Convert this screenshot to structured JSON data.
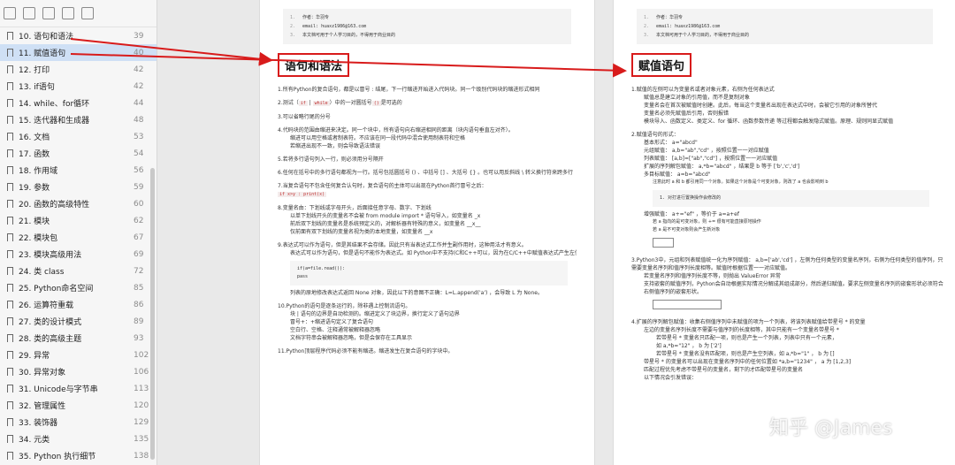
{
  "sidebar": {
    "items": [
      {
        "label": "10. 语句和语法",
        "page": "39",
        "selected": false
      },
      {
        "label": "11. 赋值语句",
        "page": "40",
        "selected": true
      },
      {
        "label": "12. 打印",
        "page": "42",
        "selected": false
      },
      {
        "label": "13. if语句",
        "page": "42",
        "selected": false
      },
      {
        "label": "14. while、for循环",
        "page": "44",
        "selected": false
      },
      {
        "label": "15. 迭代器和生成器",
        "page": "48",
        "selected": false
      },
      {
        "label": "16. 文档",
        "page": "53",
        "selected": false
      },
      {
        "label": "17. 函数",
        "page": "54",
        "selected": false
      },
      {
        "label": "18. 作用域",
        "page": "56",
        "selected": false
      },
      {
        "label": "19. 参数",
        "page": "59",
        "selected": false
      },
      {
        "label": "20. 函数的高级特性",
        "page": "60",
        "selected": false
      },
      {
        "label": "21. 模块",
        "page": "62",
        "selected": false
      },
      {
        "label": "22. 模块包",
        "page": "67",
        "selected": false
      },
      {
        "label": "23. 模块高级用法",
        "page": "69",
        "selected": false
      },
      {
        "label": "24. 类 class",
        "page": "72",
        "selected": false
      },
      {
        "label": "25. Python命名空间",
        "page": "85",
        "selected": false
      },
      {
        "label": "26. 运算符重载",
        "page": "86",
        "selected": false
      },
      {
        "label": "27. 类的设计模式",
        "page": "89",
        "selected": false
      },
      {
        "label": "28. 类的高级主题",
        "page": "93",
        "selected": false
      },
      {
        "label": "29. 异常",
        "page": "102",
        "selected": false
      },
      {
        "label": "30. 异常对象",
        "page": "106",
        "selected": false
      },
      {
        "label": "31. Unicode与字节串",
        "page": "113",
        "selected": false
      },
      {
        "label": "32. 管理属性",
        "page": "120",
        "selected": false
      },
      {
        "label": "33. 装饰器",
        "page": "129",
        "selected": false
      },
      {
        "label": "34. 元类",
        "page": "135",
        "selected": false
      },
      {
        "label": "35. Python 执行细节",
        "page": "138",
        "selected": false
      }
    ]
  },
  "page1": {
    "code_lines": [
      "作者：华羽专",
      "email: huaxz1986@163.com",
      "本文档可用于个人学习目的，不得用于商业目的"
    ],
    "title": "语句和语法",
    "p1": "1.所有Python的复合语句，都是以冒号 : 结尾，下一行缩进开始进入代码块。同一个级别代码块的缩进形式相同",
    "p2a": "2.测试（",
    "p2code1": "if",
    "p2code2": "while",
    "p2b": "）中的一对圆括号",
    "p2code3": "()",
    "p2c": "是可选的",
    "p3": "3.可以省略行尾的分号",
    "p4": "4.代码块的范围由缩进来决定。同一个块中，所有语句向右缩进相同的距离（块内语句垂直左对齐）。",
    "b4a": "缩进可以用空格或者制表符。不应该在同一段代码中混合使用制表符和空格",
    "b4b": "若缩进出现不一致，则会导致语法错误",
    "p5": "5.若将多行语句列入一行，则必须用分号隔开",
    "p6": "6.任何在括号中的多行语句都视为一行。括号包括圆括号 () 、中括号 [] 、大括号 {} 。也可以用反斜线 \\ 转义换行符来跨多行",
    "p7": "7.当复合语句不包含任何复合认句时，复合语句的主体可以出现在Python首行冒号之后：",
    "p7code": "if x>y : print(x)",
    "p8": "8.变量名由：下划线或字母开头，后面接任意字母、数字、下划线",
    "b8a": "以单下划线开头的变量名不会被 from module import * 语句导入，如变量名 _x",
    "b8b": "前后双下划线的变量名是系统预定义的，对解析器有特殊的意义，如变量名 __x__",
    "b8c": "仅前面有双下划线的变量名视为类的本地变量，如变量名 __x",
    "p9": "9.表达式可以作为语句，但是其结果不会存储。因此只有当表达式工作并生副作用时，这种用法才有意义。",
    "b9a": "表达式可以作为语句，但是语句不能作为表达式。如 Python中不支持(C和C++可以，因为在C/C++中赋值表达式产生左值)：",
    "code9": [
      "if(a=file.read()):",
      "    pass"
    ],
    "b9b": "列表的原地修改表达式返回 None 对象，因此以下的意图不正确：L=L.append('a') ，会导致 L 为 None。",
    "p10": "10.Python的语句是逐条运行的，除非遇上控制流语句。",
    "b10a": "块 | 语句的边界是自动检测的。缩进定义了块边界，换行定义了语句边界",
    "b10b": "冒号+：+缩进语句定义了复合语句",
    "b10c": "空白行、空格、注释通常被解释器忽略",
    "b10d": "文档字符串会被解释器忽略，但是会保存在工具显示",
    "p11": "11.Python顶层程序代码必须不能有缩进。缩进发生在复合语句的字块中。"
  },
  "page2": {
    "code_lines": [
      "作者：华羽专",
      "email: huaxz1986@163.com",
      "本文档可用于个人学习目的，不得用于商业目的"
    ],
    "title": "赋值语句",
    "p1": "1.赋值的左侧可以为变量名或者对象元素，右侧为任何表达式",
    "b1a": "赋值总是建立对象的引用值，而不是复制对象",
    "b1b": "变量名会在首次被赋值时创建。此后，每当这个变量名出现在表达式中时，会被它引用的对象所替代",
    "b1c": "变量名必须先赋值后引用，否则报错",
    "b1d": "模块导入、函数定义、类定义、for 循环、函数参数传递 等过程都会触发隐式赋值。原理、规则同显式赋值",
    "p2": "2.赋值语句的形式：",
    "b2a": "基本形式： a=\"abcd\"",
    "b2b": "元组赋值： a,b=\"ab\",\"cd\" ，按照位置一一对应赋值",
    "b2c": "列表赋值： [a,b]=[\"ab\",\"cd\"] ，按照位置一一对应赋值",
    "b2d": "扩展的序列解包赋值： a,*b=\"abcd\" ，结果是 b 等于 ['b','c','d']",
    "b2e": "多目标赋值： a=b=\"abcd\"",
    "b2e_note": "注意此时 a 和 b 都引用同一个对象。如果这个对象是个可变对象，则改了 a 也会影响到 b",
    "b2e_box": "1. 对打进行置换操作会修改的",
    "b2f": "增强赋值： a+=\"ef\" ，等价于 a=a+ef",
    "b2f_note1": "若 a 指向的是可变对象，则 += 很有可能直接原地操作",
    "b2f_note2": "若 a 是不可变对象则会产生新对象",
    "p3": "3.Python3中，元组和列表赋值统一化为序列赋值： a,b=['ab','cd'] ，左侧为任何类型的变量名序列，右侧为任何类型的值序列，只需要变量名序列和值序列长度相等。赋值时根据位置一一对应赋值。",
    "b3a": "若变量名序列和值序列长度不等，则抛出 ValueError 异常",
    "b3b": "支持嵌套的赋值序列，Python会自动根据实际情况分解成其组成部分，然后递归赋值。要求左侧变量名序列的嵌套形状必须符合右侧值序列的嵌套形状。",
    "p4": "4.扩展的序列解包赋值：收集右侧值序列中未赋值的项为一个列表，将该列表赋值给带星号 * 的变量",
    "b4a": "左边的变量名序列长度不需要与值序列的长度相等，其中只能有一个变量名带星号 *",
    "b4a1": "若带星号 * 变量名只匹配一项，则也是产生一个列表，列表中只有一个元素，",
    "b4a1b": "如 a,*b=\"12\" ， b 为 ['2']",
    "b4a2": "若带星号 * 变量名没有匹配项，则也是产生空列表，如 a,*b=\"1\" ， b 为 []",
    "b4b": "带星号 * 的变量名可以出现在变量名序列中的任何位置如 *a,b=\"1234\" ， a 为 [1,2,3]",
    "b4c": "匹配过程优先考虑不带星号的变量名，剩下的才匹配带星号的变量名",
    "b4d": "以下情况会引发错误："
  },
  "watermark": "知乎 @James"
}
